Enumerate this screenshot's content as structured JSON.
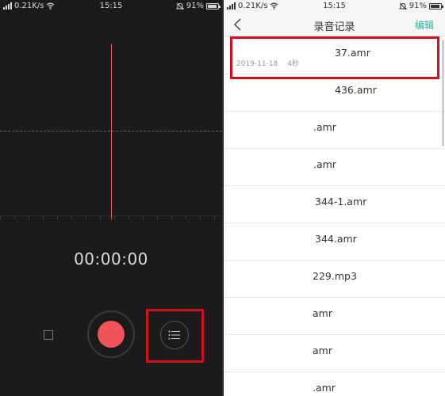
{
  "left": {
    "status": {
      "net_speed": "0.21K/s",
      "time": "15:15",
      "battery": "91%"
    },
    "timer": "00:00:00"
  },
  "right": {
    "status": {
      "net_speed": "0.21K/s",
      "time": "15:15",
      "battery": "91%"
    },
    "title": "录音记录",
    "edit_label": "编辑",
    "recordings": [
      {
        "name": "37.amr",
        "date": "2019-11-18",
        "duration": "4秒"
      },
      {
        "name": "436.amr"
      },
      {
        "name": ".amr"
      },
      {
        "name": ".amr"
      },
      {
        "name": "344-1.amr"
      },
      {
        "name": "344.amr"
      },
      {
        "name": "229.mp3"
      },
      {
        "name": "amr"
      },
      {
        "name": "amr"
      },
      {
        "name": ".amr"
      }
    ]
  },
  "colors": {
    "record_red": "#f0535a",
    "accent_teal": "#27b3a3",
    "highlight_red": "#d4101c"
  },
  "icons": [
    "signal-icon",
    "wifi-icon",
    "alarm-icon",
    "battery-icon",
    "back-icon",
    "stop-icon",
    "record-icon",
    "list-icon"
  ]
}
